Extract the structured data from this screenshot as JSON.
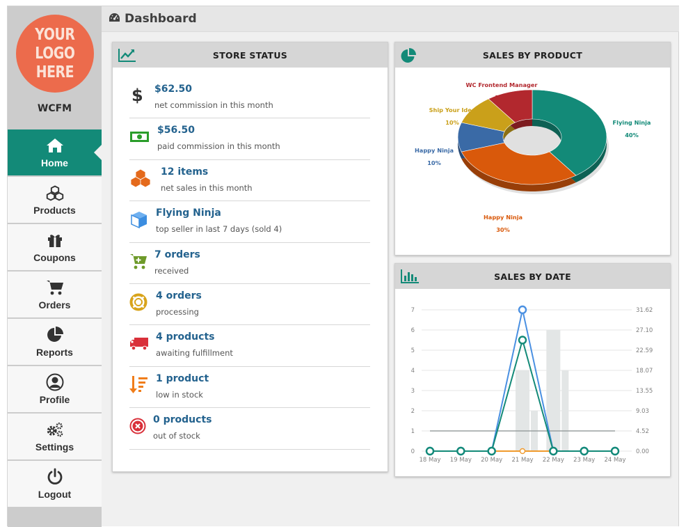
{
  "sidebar": {
    "logo_text": "YOUR\nLOGO\nHERE",
    "store_name": "WCFM",
    "items": [
      {
        "label": "Home",
        "icon": "home-icon"
      },
      {
        "label": "Products",
        "icon": "cubes-icon"
      },
      {
        "label": "Coupons",
        "icon": "gift-icon"
      },
      {
        "label": "Orders",
        "icon": "cart-icon"
      },
      {
        "label": "Reports",
        "icon": "pie-chart-icon"
      },
      {
        "label": "Profile",
        "icon": "user-circle-icon"
      },
      {
        "label": "Settings",
        "icon": "gears-icon"
      },
      {
        "label": "Logout",
        "icon": "power-icon"
      }
    ]
  },
  "header": {
    "title": "Dashboard",
    "icon": "dashboard-gauge-icon"
  },
  "store_status": {
    "title": "STORE STATUS",
    "items": [
      {
        "value": "$62.50",
        "desc": "net commission in this month",
        "icon": "dollar-icon",
        "color": "#333333"
      },
      {
        "value": "$56.50",
        "desc": "paid commission in this month",
        "icon": "money-bill-icon",
        "color": "#2a9d2a"
      },
      {
        "value": "12 items",
        "desc": "net sales in this month",
        "icon": "cubes-icon",
        "color": "#e46a1c"
      },
      {
        "value": "Flying Ninja",
        "desc": "top seller in last 7 days (sold 4)",
        "icon": "cube-icon",
        "color": "#3b8de0"
      },
      {
        "value": "7 orders",
        "desc": "received",
        "icon": "cart-plus-icon",
        "color": "#6e9a2a"
      },
      {
        "value": "4 orders",
        "desc": "processing",
        "icon": "lifebuoy-icon",
        "color": "#d8a31a"
      },
      {
        "value": "4 products",
        "desc": "awaiting fulfillment",
        "icon": "truck-icon",
        "color": "#d9303a"
      },
      {
        "value": "1 product",
        "desc": "low in stock",
        "icon": "sort-amount-icon",
        "color": "#f07d1a"
      },
      {
        "value": "0 products",
        "desc": "out of stock",
        "icon": "times-circle-icon",
        "color": "#d9303a"
      }
    ]
  },
  "sales_by_product": {
    "title": "SALES BY PRODUCT",
    "icon": "pie-chart-icon"
  },
  "sales_by_date": {
    "title": "SALES BY DATE",
    "icon": "bar-chart-icon"
  },
  "chart_data": [
    {
      "type": "pie",
      "categories": [
        "Flying Ninja",
        "Happy Ninja",
        "Happy Ninja",
        "Ship Your Idea",
        "WC Frontend Manager"
      ],
      "values": [
        40,
        30,
        10,
        10,
        10
      ],
      "labels": [
        "40%",
        "30%",
        "10%",
        "10%",
        "10%"
      ],
      "colors": [
        "#138a78",
        "#d9590b",
        "#3a6aa6",
        "#caa01a",
        "#b2282e"
      ],
      "donut": true
    },
    {
      "type": "line",
      "x": [
        "18 May",
        "19 May",
        "20 May",
        "21 May",
        "22 May",
        "23 May",
        "24 May"
      ],
      "ylim": [
        0,
        7
      ],
      "y_ticks": [
        0,
        1,
        2,
        3,
        4,
        5,
        6,
        7
      ],
      "y2_ticks": [
        "0.00",
        "4.52",
        "9.03",
        "13.55",
        "18.07",
        "22.59",
        "27.10",
        "31.62"
      ],
      "grid": true,
      "series": [
        {
          "kind": "line",
          "color": "#4a90e2",
          "values": [
            0,
            0,
            0,
            7,
            0,
            0,
            0
          ]
        },
        {
          "kind": "line",
          "color": "#138a78",
          "values": [
            0,
            0,
            0,
            5.5,
            0,
            0,
            0
          ]
        },
        {
          "kind": "line",
          "color": "#f09a2c",
          "values": [
            0,
            0,
            0,
            0,
            0,
            0,
            0
          ]
        },
        {
          "kind": "line",
          "color": "#9aa0a0",
          "values": [
            1,
            1,
            1,
            1,
            1,
            1,
            1
          ]
        },
        {
          "kind": "bar",
          "color": "#e3e6e6",
          "values": [
            0,
            0,
            0,
            4,
            6,
            0,
            0
          ]
        },
        {
          "kind": "bar",
          "color": "#e3e6e6",
          "values": [
            0,
            0,
            0,
            2,
            4,
            0,
            0
          ]
        }
      ]
    }
  ]
}
